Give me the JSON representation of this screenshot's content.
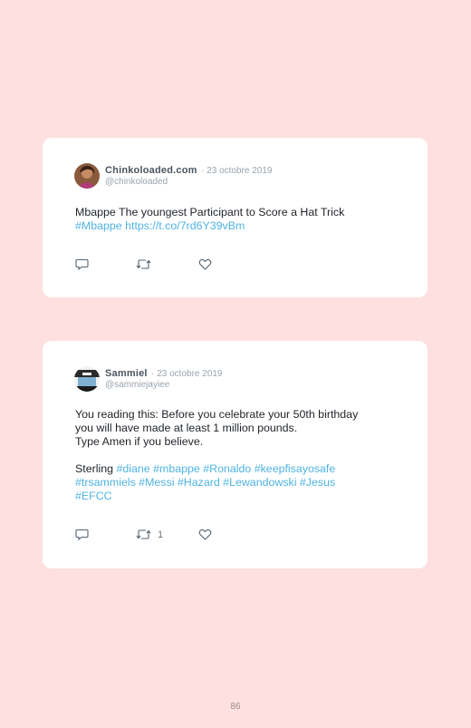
{
  "tweets": [
    {
      "author": "Chinkoloaded.com",
      "date": "· 23 octobre 2019",
      "handle": "@chinkoloaded",
      "lines": [
        {
          "text": "Mbappe The youngest Participant to Score a Hat Trick"
        },
        {
          "link": "#Mbappe https://t.co/7rd6Y39vBm"
        }
      ],
      "retweets": ""
    },
    {
      "author": "Sammiel",
      "date": "· 23 octobre 2019",
      "handle": "@sammiejayiee",
      "lines": [
        {
          "text": "You reading this: Before you celebrate your 50th birthday"
        },
        {
          "text": "you will have made at least 1 million pounds."
        },
        {
          "text": "Type Amen if you believe."
        },
        {
          "prefix": "Sterling ",
          "link": "#diane #mbappe #Ronaldo #keepfisayosafe"
        },
        {
          "link": "#trsammiels #Messi #Hazard #Lewandowski #Jesus"
        },
        {
          "link": "#EFCC"
        }
      ],
      "retweets": "1"
    }
  ],
  "icons": [
    "reply-icon",
    "retweet-icon",
    "like-icon"
  ],
  "colors": {
    "background": "#fde0df",
    "card": "#ffffff",
    "link": "#4fb3e2"
  },
  "page_number": "86"
}
